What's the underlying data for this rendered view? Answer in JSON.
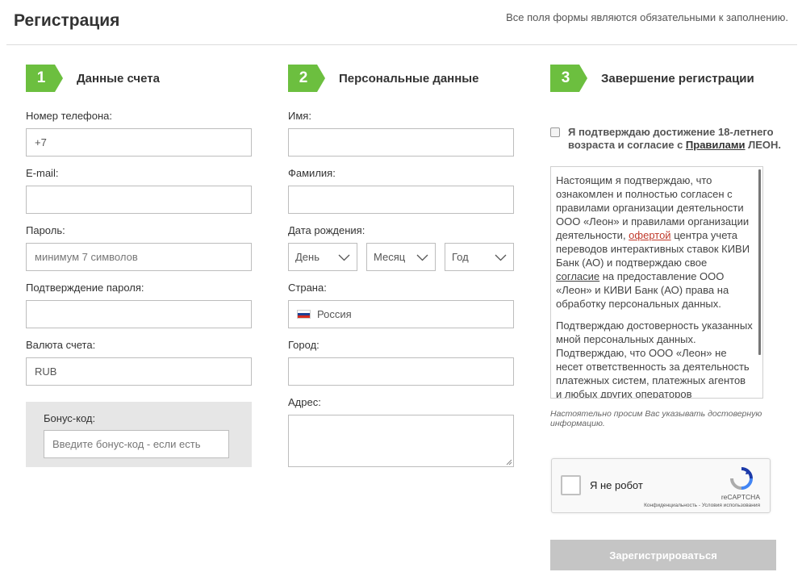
{
  "page": {
    "title": "Регистрация",
    "required_note": "Все поля формы являются обязательными к заполнению."
  },
  "steps": [
    {
      "number": "1",
      "title": "Данные счета"
    },
    {
      "number": "2",
      "title": "Персональные данные"
    },
    {
      "number": "3",
      "title": "Завершение регистрации"
    }
  ],
  "account": {
    "phone_label": "Номер телефона:",
    "phone_value": "+7",
    "email_label": "E-mail:",
    "email_value": "",
    "password_label": "Пароль:",
    "password_placeholder": "минимум 7 символов",
    "confirm_label": "Подтверждение пароля:",
    "confirm_value": "",
    "currency_label": "Валюта счета:",
    "currency_value": "RUB",
    "bonus_label": "Бонус-код:",
    "bonus_placeholder": "Введите бонус-код - если есть"
  },
  "personal": {
    "name_label": "Имя:",
    "surname_label": "Фамилия:",
    "birth_label": "Дата рождения:",
    "day_option": "День",
    "month_option": "Месяц",
    "year_option": "Год",
    "country_label": "Страна:",
    "country_value": "Россия",
    "city_label": "Город:",
    "address_label": "Адрес:"
  },
  "finish": {
    "agree_text_before": "Я подтверждаю достижение 18-летнего возраста и согласие с ",
    "agree_link": "Правилами",
    "agree_text_after": " ЛЕОН.",
    "terms_p1_a": "Настоящим я подтверждаю, что ознакомлен и полностью согласен с правилами организации деятельности ООО «Леон» и правилами организации деятельности, ",
    "terms_p1_link1": "офертой",
    "terms_p1_b": " центра учета переводов интерактивных ставок КИВИ Банк (АО) и подтверждаю свое ",
    "terms_p1_link2": "согласие",
    "terms_p1_c": " на предоставление ООО «Леон» и КИВИ Банк (АО) права на обработку персональных данных.",
    "terms_p2": "Подтверждаю достоверность указанных мной персональных данных. Подтверждаю, что ООО «Леон» не несет ответственность за деятельность платежных систем, платежных агентов и любых других операторов",
    "accuracy_note": "Настоятельно просим Вас указывать достоверную информацию.",
    "captcha_label": "Я не робот",
    "captcha_brand": "reCAPTCHA",
    "captcha_links": "Конфиденциальность - Условия использования",
    "submit_label": "Зарегистрироваться"
  },
  "colors": {
    "accent": "#6cbf3f",
    "submit_disabled": "#c5c5c5",
    "link_red": "#c0392b"
  }
}
